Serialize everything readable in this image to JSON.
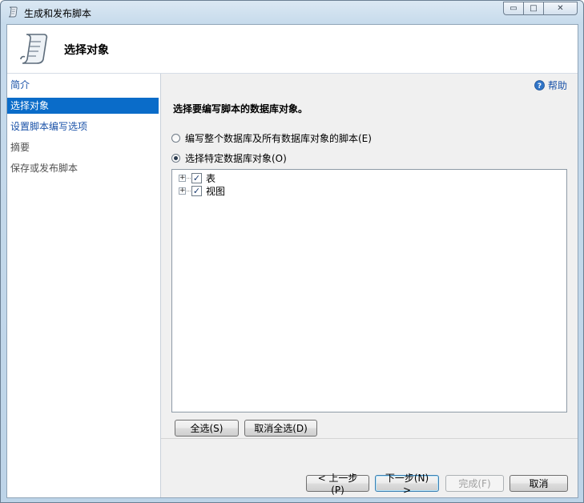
{
  "window": {
    "title": "生成和发布脚本",
    "minimize_glyph": "▭",
    "maximize_glyph": "□",
    "close_glyph": "✕"
  },
  "header": {
    "title": "选择对象",
    "icon": "script-scroll-icon"
  },
  "sidebar": {
    "items": [
      {
        "label": "简介",
        "state": "link"
      },
      {
        "label": "选择对象",
        "state": "active"
      },
      {
        "label": "设置脚本编写选项",
        "state": "link"
      },
      {
        "label": "摘要",
        "state": "disabled"
      },
      {
        "label": "保存或发布脚本",
        "state": "disabled"
      }
    ]
  },
  "main": {
    "help_label": "帮助",
    "heading": "选择要编写脚本的数据库对象。",
    "options": [
      {
        "label": "编写整个数据库及所有数据库对象的脚本(E)",
        "checked": false
      },
      {
        "label": "选择特定数据库对象(O)",
        "checked": true
      }
    ],
    "tree": [
      {
        "label": "表",
        "checked": true,
        "expander": "+"
      },
      {
        "label": "视图",
        "checked": true,
        "expander": "+"
      }
    ],
    "select_all_label": "全选(S)",
    "deselect_all_label": "取消全选(D)"
  },
  "footer": {
    "prev_label": "< 上一步(P)",
    "next_label": "下一步(N) >",
    "finish_label": "完成(F)",
    "cancel_label": "取消"
  },
  "colors": {
    "active_nav": "#0a6cc9",
    "link": "#1a52a8"
  }
}
